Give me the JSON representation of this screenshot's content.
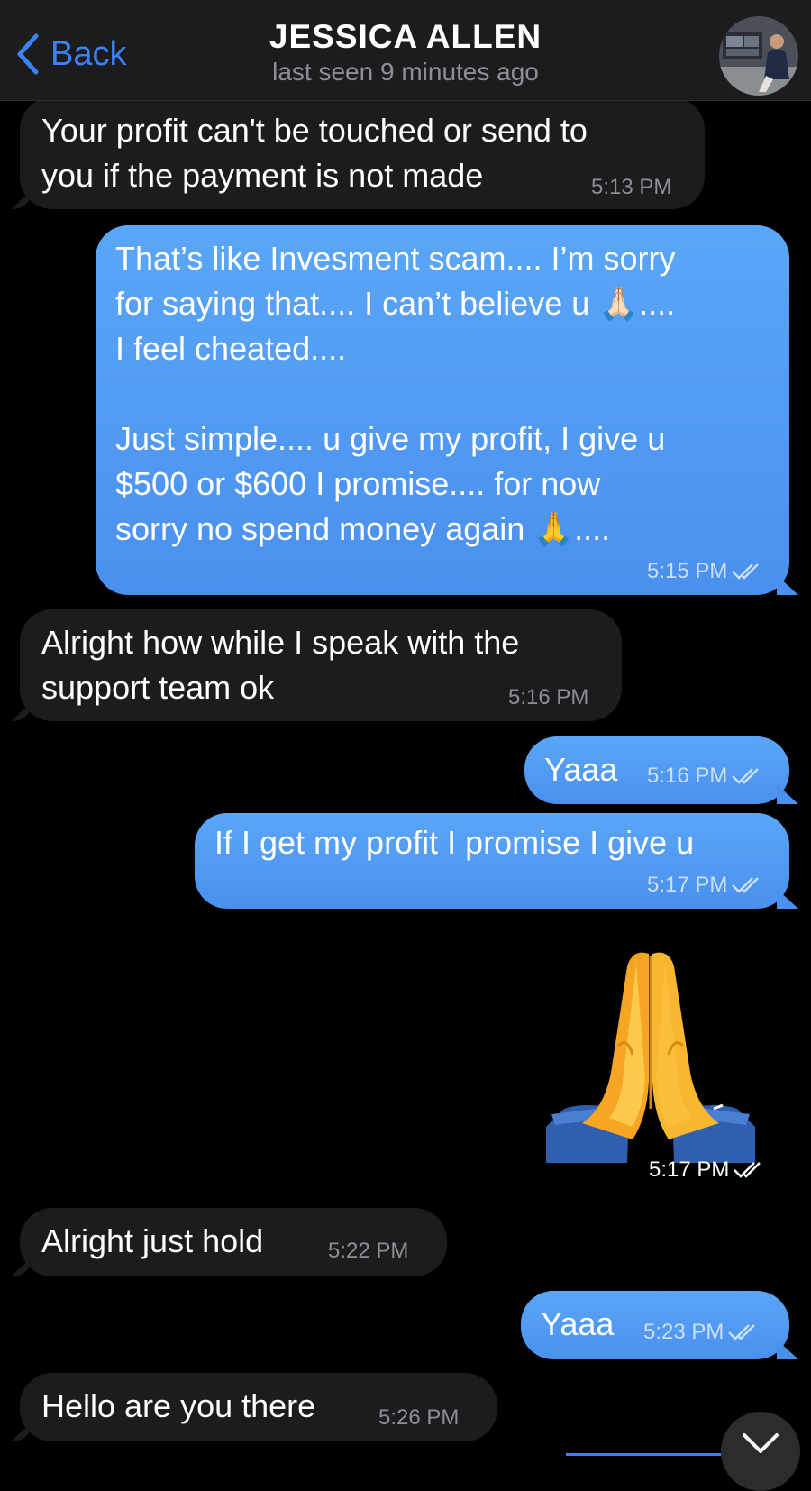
{
  "header": {
    "back_label": "Back",
    "title": "JESSICA ALLEN",
    "subtitle": "last seen 9 minutes ago",
    "accent_color": "#3b82f6"
  },
  "messages": [
    {
      "direction": "in",
      "text": "Your profit can't be touched or send to\nyou if the payment is not made",
      "time": "5:13 PM"
    },
    {
      "direction": "out",
      "text": "That’s like Invesment scam.... I’m sorry\nfor saying that.... I can’t believe u 🙏🏻....\nI feel cheated....\n\nJust simple.... u give my profit, I give u\n$500 or $600 I promise.... for now\nsorry no spend money again 🙏....",
      "time": "5:15 PM",
      "status": "read"
    },
    {
      "direction": "in",
      "text": "Alright how while I speak with the\nsupport team ok",
      "time": "5:16 PM"
    },
    {
      "direction": "out",
      "text": "Yaaa",
      "time": "5:16 PM",
      "status": "read"
    },
    {
      "direction": "out",
      "text": "If I get my profit I promise I give u",
      "time": "5:17 PM",
      "status": "read"
    },
    {
      "direction": "out",
      "sticker": "folded-hands",
      "time": "5:17 PM",
      "status": "read"
    },
    {
      "direction": "in",
      "text": "Alright just hold",
      "time": "5:22 PM"
    },
    {
      "direction": "out",
      "text": "Yaaa",
      "time": "5:23 PM",
      "status": "read"
    },
    {
      "direction": "in",
      "text": "Hello are you there",
      "time": "5:26 PM"
    }
  ],
  "icons": {
    "back": "chevron-left-icon",
    "read_receipt": "double-check-icon",
    "scroll_down": "chevron-down-icon"
  },
  "colors": {
    "incoming_bubble": "#1c1c1e",
    "outgoing_bubble": "#4a90ee",
    "background": "#000000"
  }
}
